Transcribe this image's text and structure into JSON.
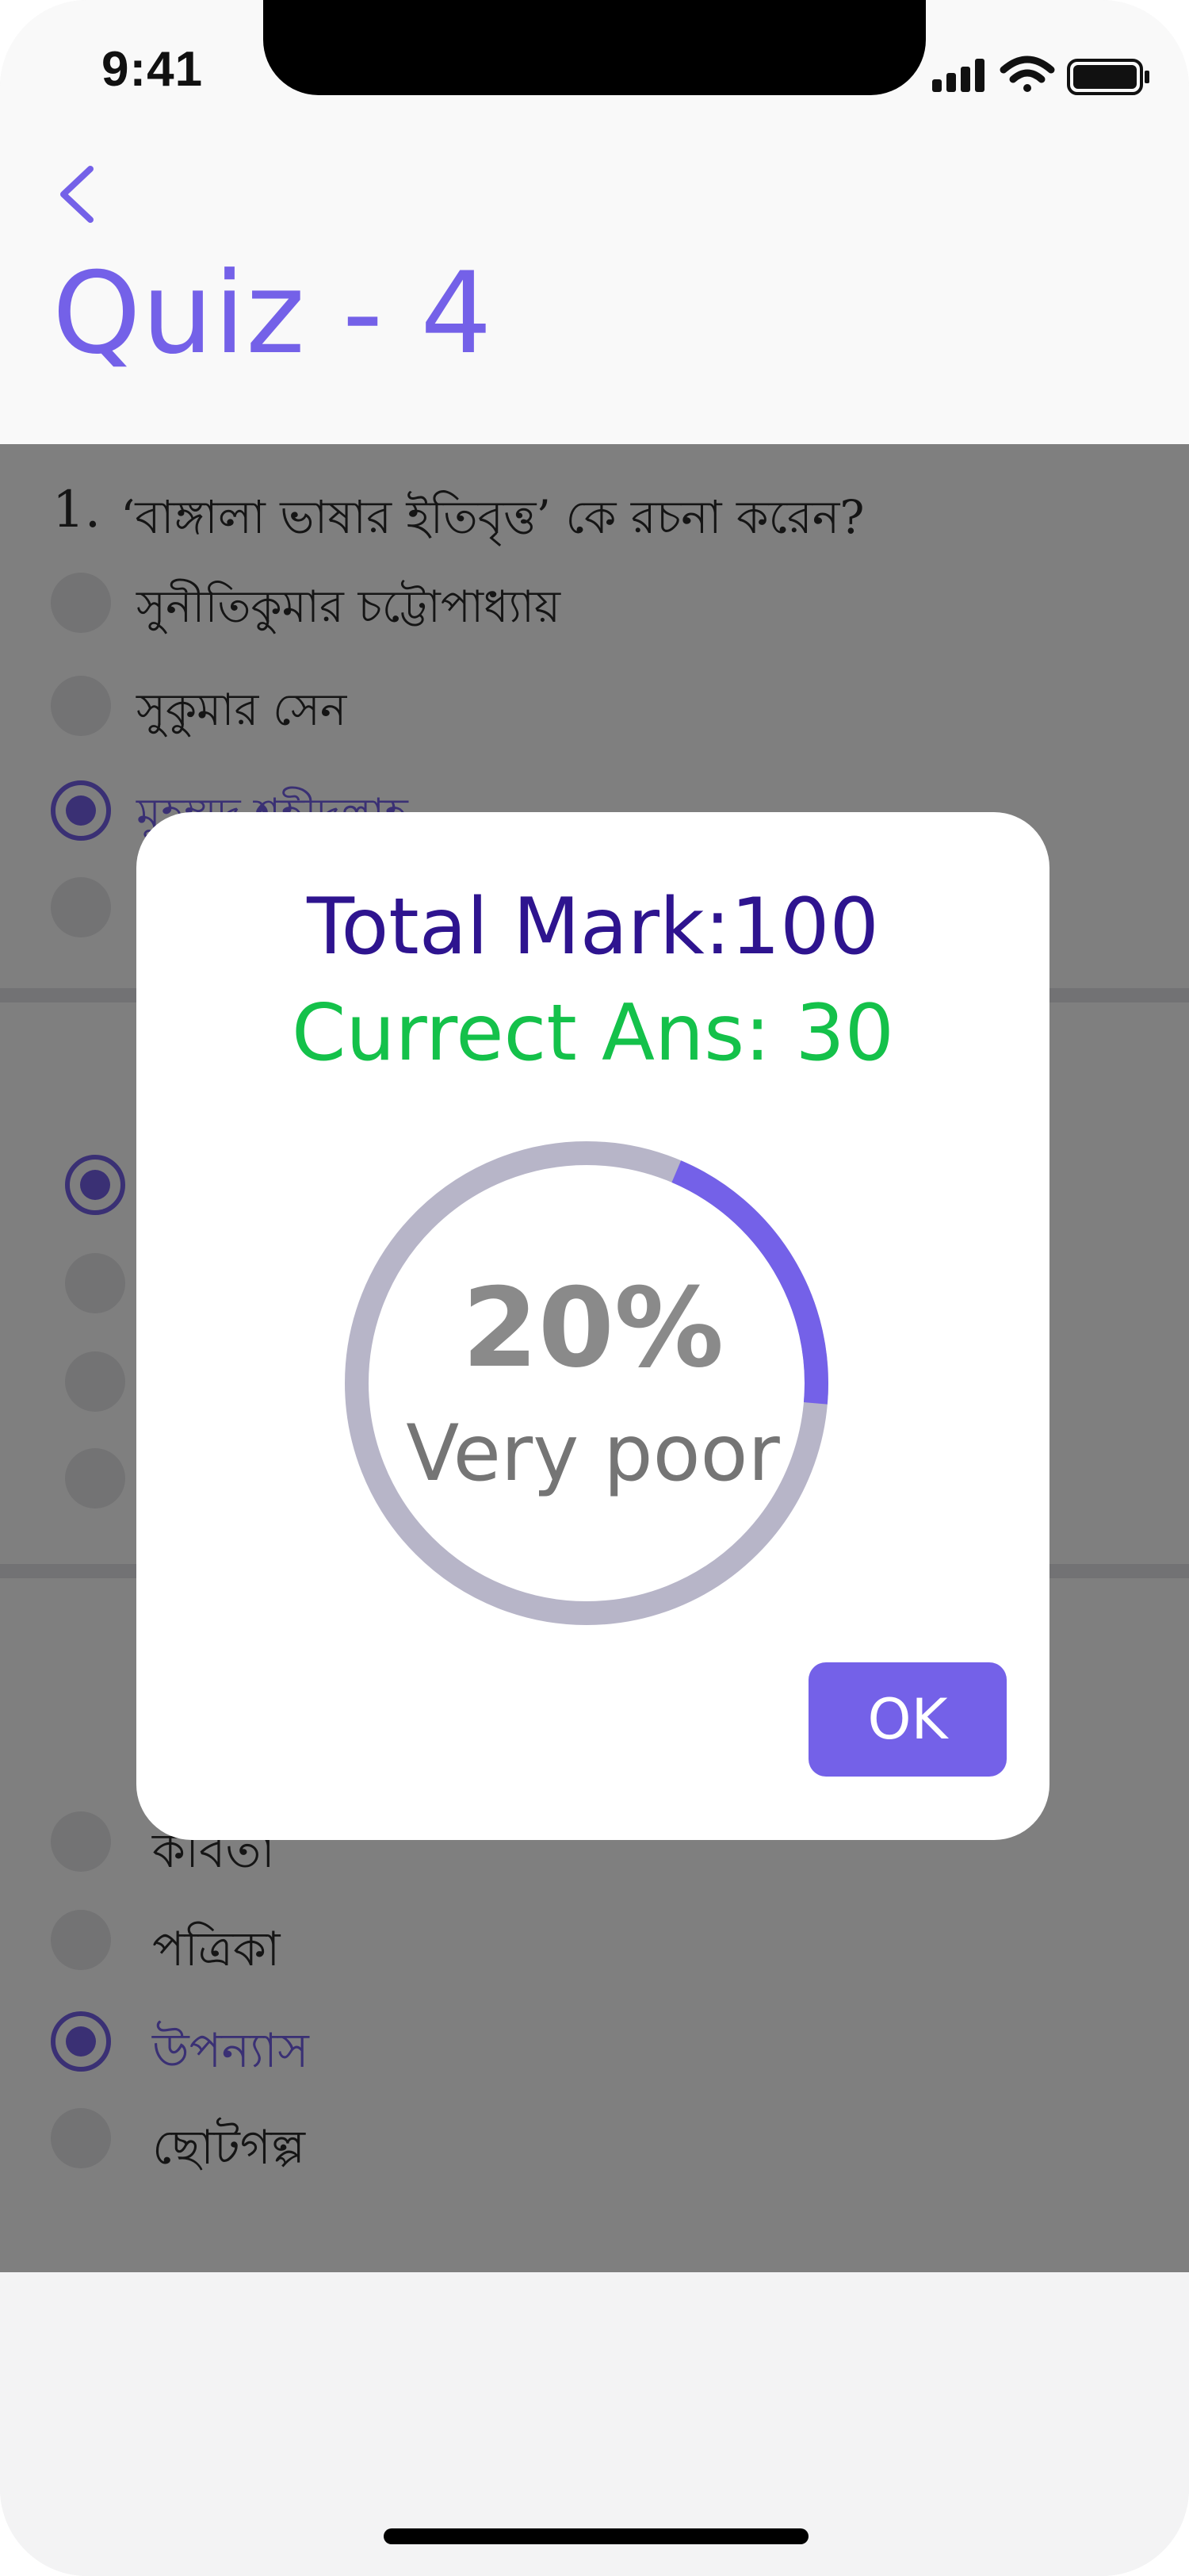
{
  "status_bar": {
    "time": "9:41"
  },
  "header": {
    "title": "Quiz - 4"
  },
  "questions": [
    {
      "number": "1.",
      "text": "‘বাঙ্গালা ভাষার ইতিবৃত্ত’ কে রচনা করেন?",
      "options": [
        "সুনীতিকুমার চট্টোপাধ্যায়",
        "সুকুমার সেন",
        "মুহম্মদ শহীদুল্লাহ"
      ]
    },
    {
      "options": [
        "কবিতা",
        "পত্রিকা",
        "উপন্যাস",
        "ছোটগল্প"
      ]
    }
  ],
  "result_dialog": {
    "total_mark": "Total Mark:100",
    "correct_answers": "Currect Ans: 30",
    "percent_text": "20%",
    "score_fraction": 0.2,
    "grade": "Very poor",
    "ok_label": "OK",
    "ring_track_color": "#b7b5c8",
    "ring_fill_color": "#7461e8"
  }
}
